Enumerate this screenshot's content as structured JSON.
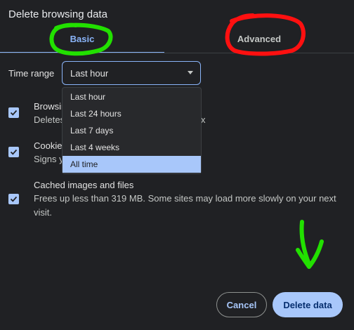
{
  "dialog": {
    "title": "Delete browsing data"
  },
  "tabs": [
    {
      "label": "Basic",
      "active": true
    },
    {
      "label": "Advanced",
      "active": false
    }
  ],
  "time_range": {
    "label": "Time range",
    "selected": "Last hour",
    "options": [
      "Last hour",
      "Last 24 hours",
      "Last 7 days",
      "Last 4 weeks",
      "All time"
    ],
    "highlighted_option": "All time"
  },
  "options": [
    {
      "title": "Browsing history",
      "description": "Deletes history from all synced devices. 0 hours (1 tab)",
      "checked": true
    },
    {
      "title": "Cookies and other site data",
      "description": "Signs you out of most sites.",
      "checked": true
    },
    {
      "title": "Cached images and files",
      "description": "Frees up less than 319 MB. Some sites may load more slowly on your next",
      "description_2": "visit.",
      "checked": true
    }
  ],
  "visible_fragments": {
    "row1_title": "Browsing",
    "row1_desc_start": "Deletes",
    "row1_desc_end": "x",
    "row2_title": "Cookie",
    "row2_desc_start": "Signs y"
  },
  "buttons": {
    "cancel": "Cancel",
    "delete": "Delete data"
  },
  "colors": {
    "accent": "#8ab4f8",
    "annotation_green": "#22e000",
    "annotation_red": "#ff1010"
  }
}
